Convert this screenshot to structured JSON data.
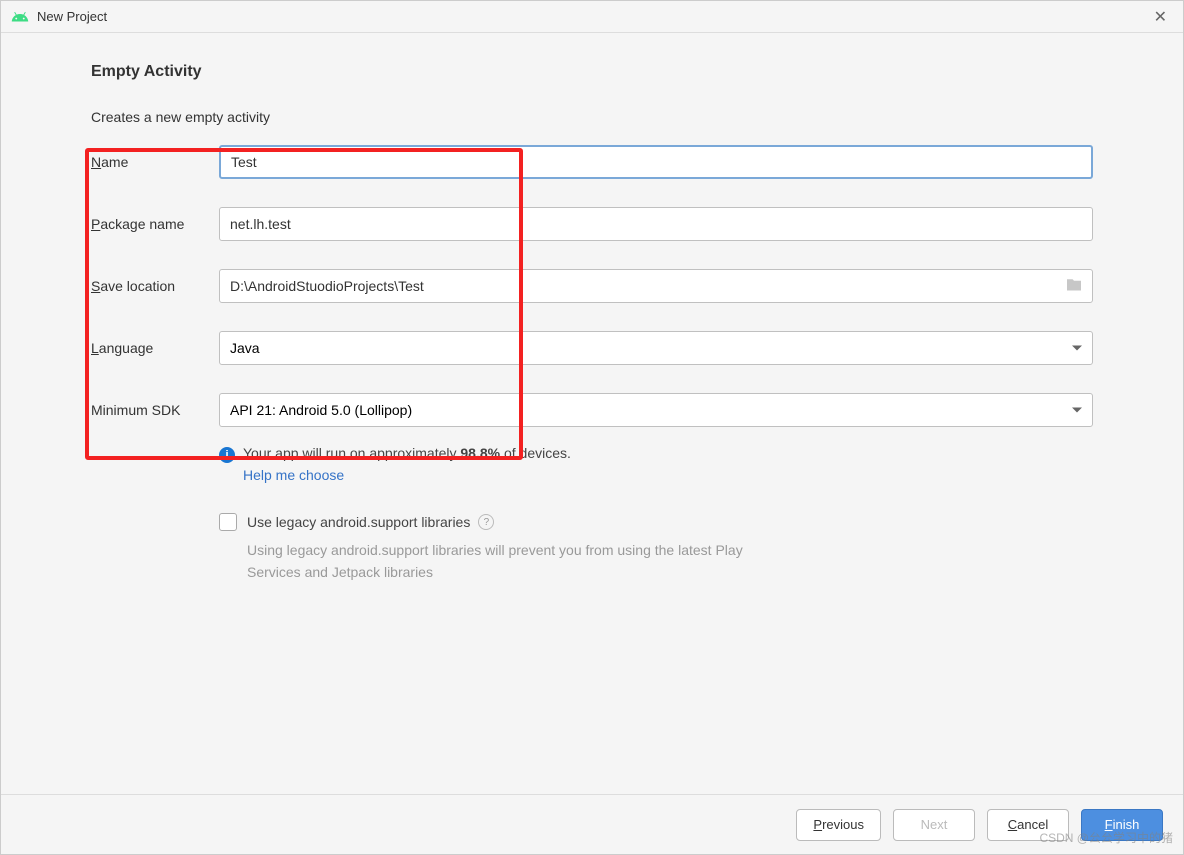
{
  "window": {
    "title": "New Project"
  },
  "header": {
    "title": "Empty Activity",
    "subtitle": "Creates a new empty activity"
  },
  "form": {
    "name": {
      "label": "Name",
      "value": "Test"
    },
    "package": {
      "label": "Package name",
      "value": "net.lh.test"
    },
    "location": {
      "label": "Save location",
      "value": "D:\\AndroidStuodioProjects\\Test"
    },
    "language": {
      "label": "Language",
      "value": "Java"
    },
    "minsdk": {
      "label": "Minimum SDK",
      "value": "API 21: Android 5.0 (Lollipop)"
    }
  },
  "info": {
    "text_pre": "Your app will run on approximately ",
    "percent": "98.8%",
    "text_post": " of devices.",
    "help_link": "Help me choose"
  },
  "legacy": {
    "label": "Use legacy android.support libraries",
    "desc": "Using legacy android.support libraries will prevent you from using the latest Play Services and Jetpack libraries"
  },
  "footer": {
    "previous": "Previous",
    "next": "Next",
    "cancel": "Cancel",
    "finish": "Finish"
  },
  "watermark": "CSDN @㕕㕕学习中的猪"
}
